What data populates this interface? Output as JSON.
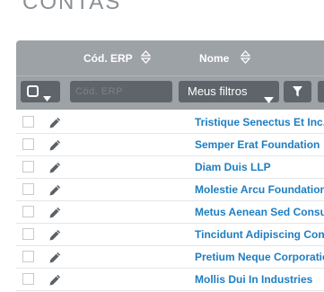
{
  "page": {
    "title": "CONTAS"
  },
  "grid": {
    "columns": [
      {
        "key": "erp",
        "label": "Cód. ERP"
      },
      {
        "key": "name",
        "label": "Nome"
      }
    ],
    "filters": {
      "erp_placeholder": "Cód. ERP",
      "meus_filtros_label": "Meus filtros"
    },
    "rows": [
      {
        "name": "Tristique Senectus Et Inc."
      },
      {
        "name": "Semper Erat Foundation"
      },
      {
        "name": "Diam Duis LLP"
      },
      {
        "name": "Molestie Arcu Foundation"
      },
      {
        "name": "Metus Aenean Sed Consult"
      },
      {
        "name": "Tincidunt Adipiscing Consu"
      },
      {
        "name": "Pretium Neque Corporation"
      },
      {
        "name": "Mollis Dui In Industries"
      }
    ]
  },
  "colors": {
    "header_bg": "#9da2a6",
    "control_bg": "#5e6469",
    "link": "#1e7ec2"
  }
}
